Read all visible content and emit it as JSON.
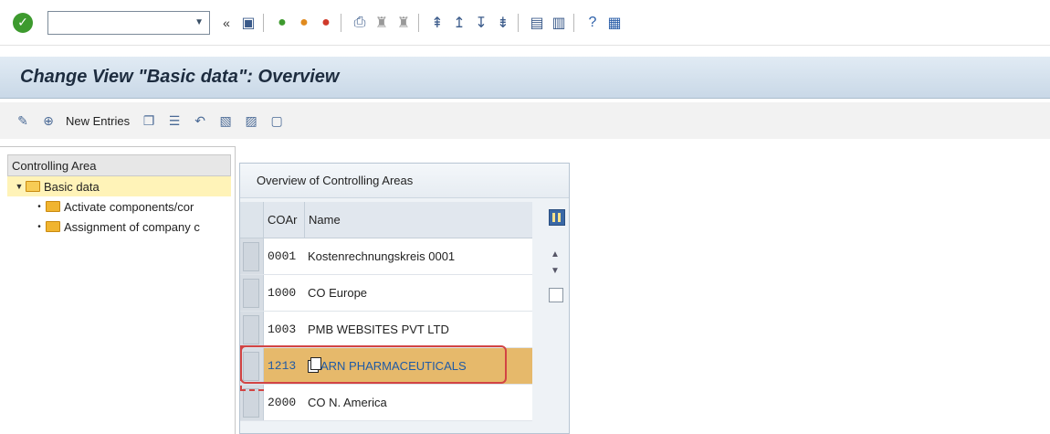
{
  "system_toolbar": {
    "command_value": "",
    "command_placeholder": "",
    "icons": [
      "enter-icon",
      "dropdown-icon",
      "double-left-icon",
      "save-icon",
      "back-icon",
      "exit-icon",
      "cancel-icon",
      "print-icon",
      "find-icon",
      "find-next-icon",
      "first-page-icon",
      "previous-page-icon",
      "next-page-icon",
      "last-page-icon",
      "new-session-icon",
      "shortcut-icon",
      "help-icon",
      "layout-icon"
    ],
    "double_chevron": "«"
  },
  "title": "Change View \"Basic data\": Overview",
  "app_toolbar": {
    "new_entries_label": "New Entries"
  },
  "tree": {
    "header": "Controlling Area",
    "root": "Basic data",
    "children": [
      "Activate components/cor",
      "Assignment of company c"
    ]
  },
  "table": {
    "title": "Overview of Controlling Areas",
    "columns": {
      "coar": "COAr",
      "name": "Name"
    },
    "rows": [
      {
        "coar": "0001",
        "name": "Kostenrechnungskreis 0001"
      },
      {
        "coar": "1000",
        "name": "CO Europe"
      },
      {
        "coar": "1003",
        "name": "PMB WEBSITES PVT LTD"
      },
      {
        "coar": "1213",
        "name": "ARN PHARMACEUTICALS"
      },
      {
        "coar": "2000",
        "name": "CO N. America"
      }
    ]
  },
  "colors": {
    "title_bg": "#c9d8e7",
    "highlight_row": "#e6b96b",
    "selected_tree": "#fff3b8",
    "red_outline": "#d24444"
  }
}
